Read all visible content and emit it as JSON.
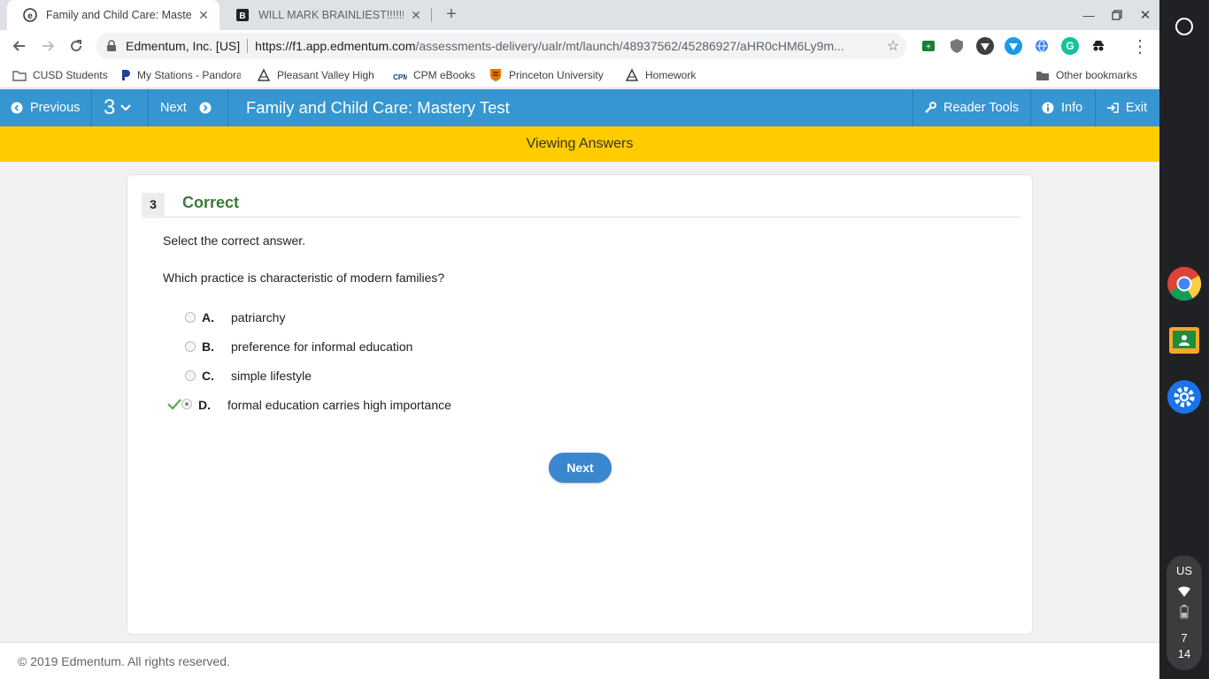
{
  "browser": {
    "tabs": [
      {
        "title": "Family and Child Care: Mastery Test",
        "active": true
      },
      {
        "title": "WILL MARK BRAINLIEST!!!!!! Which",
        "active": false
      }
    ],
    "site_label": "Edmentum, Inc. [US]",
    "url_domain": "https://f1.app.edmentum.com",
    "url_path": "/assessments-delivery/ualr/mt/launch/48937562/45286927/aHR0cHM6Ly9m...",
    "bookmarks": [
      "CUSD Students",
      "My Stations - Pandora",
      "Pleasant Valley High",
      "CPM eBooks",
      "Princeton University",
      "Homework"
    ],
    "other_bookmarks": "Other bookmarks"
  },
  "appbar": {
    "previous_label": "Previous",
    "question_number": "3",
    "next_label": "Next",
    "title": "Family and Child Care: Mastery Test",
    "reader_tools_label": "Reader Tools",
    "info_label": "Info",
    "exit_label": "Exit"
  },
  "banner": "Viewing Answers",
  "question": {
    "number": "3",
    "status": "Correct",
    "instruction": "Select the correct answer.",
    "prompt": "Which practice is characteristic of modern families?",
    "options": [
      {
        "letter": "A.",
        "text": "patriarchy",
        "selected": false
      },
      {
        "letter": "B.",
        "text": "preference for informal education",
        "selected": false
      },
      {
        "letter": "C.",
        "text": "simple lifestyle",
        "selected": false
      },
      {
        "letter": "D.",
        "text": "formal education carries high importance",
        "selected": true,
        "correct": true
      }
    ],
    "next_button": "Next"
  },
  "footer": "© 2019 Edmentum. All rights reserved.",
  "system_tray": {
    "locale": "US",
    "hour": "7",
    "minute": "14"
  },
  "colors": {
    "appbar": "#3596d1",
    "banner": "#ffcc00",
    "correct": "#3b7a3b",
    "next_button": "#3a87cf"
  }
}
